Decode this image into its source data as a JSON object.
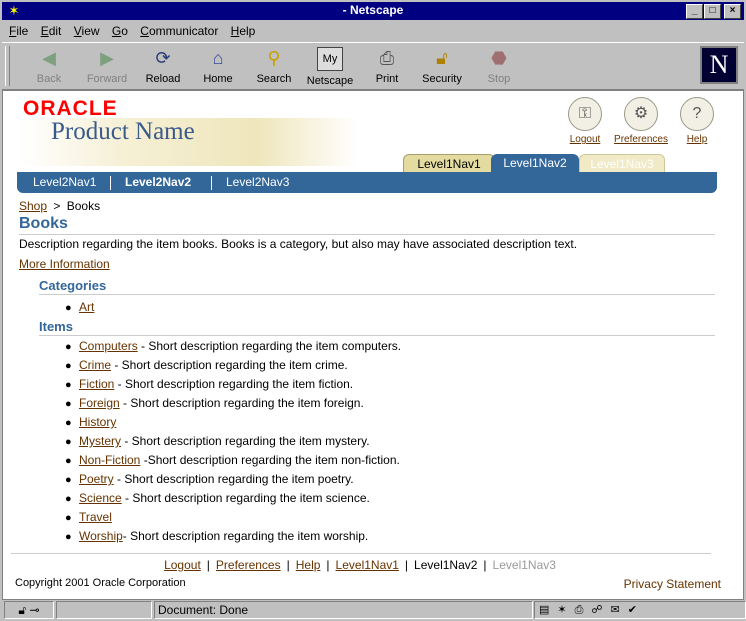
{
  "window": {
    "title": "- Netscape"
  },
  "menu": [
    "File",
    "Edit",
    "View",
    "Go",
    "Communicator",
    "Help"
  ],
  "toolbar": {
    "buttons": [
      {
        "label": "Back",
        "icon": "back-arrow-icon",
        "enabled": false
      },
      {
        "label": "Forward",
        "icon": "forward-arrow-icon",
        "enabled": false
      },
      {
        "label": "Reload",
        "icon": "reload-icon",
        "enabled": true
      },
      {
        "label": "Home",
        "icon": "home-icon",
        "enabled": true
      },
      {
        "label": "Search",
        "icon": "search-icon",
        "enabled": true
      },
      {
        "label": "Netscape",
        "icon": "netscape-icon",
        "enabled": true
      },
      {
        "label": "Print",
        "icon": "print-icon",
        "enabled": true
      },
      {
        "label": "Security",
        "icon": "lock-icon",
        "enabled": true
      },
      {
        "label": "Stop",
        "icon": "stop-icon",
        "enabled": false
      }
    ]
  },
  "page": {
    "logo": "ORACLE",
    "product_name": "Product Name",
    "global_buttons": [
      {
        "label": "Logout",
        "icon": "logout-icon"
      },
      {
        "label": "Preferences",
        "icon": "preferences-icon"
      },
      {
        "label": "Help",
        "icon": "help-icon"
      }
    ],
    "tabs": [
      "Level1Nav1",
      "Level1Nav2",
      "Level1Nav3"
    ],
    "selected_tab": "Level1Nav2",
    "level2": [
      "Level2Nav1",
      "Level2Nav2",
      "Level2Nav3"
    ],
    "selected_level2": "Level2Nav2",
    "breadcrumb": {
      "link": "Shop",
      "separator": ">",
      "current": "Books"
    },
    "title": "Books",
    "description": "Description regarding the item books. Books is a category, but also may have associated description text.",
    "more_link": "More Information",
    "categories_header": "Categories",
    "categories": [
      "Art"
    ],
    "items_header": "Items",
    "items": [
      {
        "name": "Computers",
        "desc": " - Short description regarding the item computers."
      },
      {
        "name": "Crime",
        "desc": " - Short description regarding the item crime."
      },
      {
        "name": "Fiction",
        "desc": " - Short description regarding the item fiction."
      },
      {
        "name": "Foreign",
        "desc": " - Short description regarding the item foreign."
      },
      {
        "name": "History",
        "desc": ""
      },
      {
        "name": "Mystery",
        "desc": " - Short description regarding the item mystery."
      },
      {
        "name": "Non-Fiction",
        "desc": " -Short description regarding the item non-fiction."
      },
      {
        "name": "Poetry",
        "desc": " - Short description regarding the item poetry."
      },
      {
        "name": "Science",
        "desc": " - Short description regarding the item science."
      },
      {
        "name": "Travel",
        "desc": ""
      },
      {
        "name": "Worship",
        "desc": "- Short description regarding the item worship."
      }
    ],
    "footer_links": [
      "Logout",
      "Preferences",
      "Help",
      "Level1Nav1",
      "Level1Nav2",
      "Level1Nav3"
    ],
    "copyright": "Copyright 2001 Oracle Corporation",
    "privacy": "Privacy Statement"
  },
  "status": {
    "text": "Document: Done"
  },
  "colors": {
    "brand_red": "#ff0000",
    "nav_blue": "#336699",
    "link_brown": "#663300"
  }
}
